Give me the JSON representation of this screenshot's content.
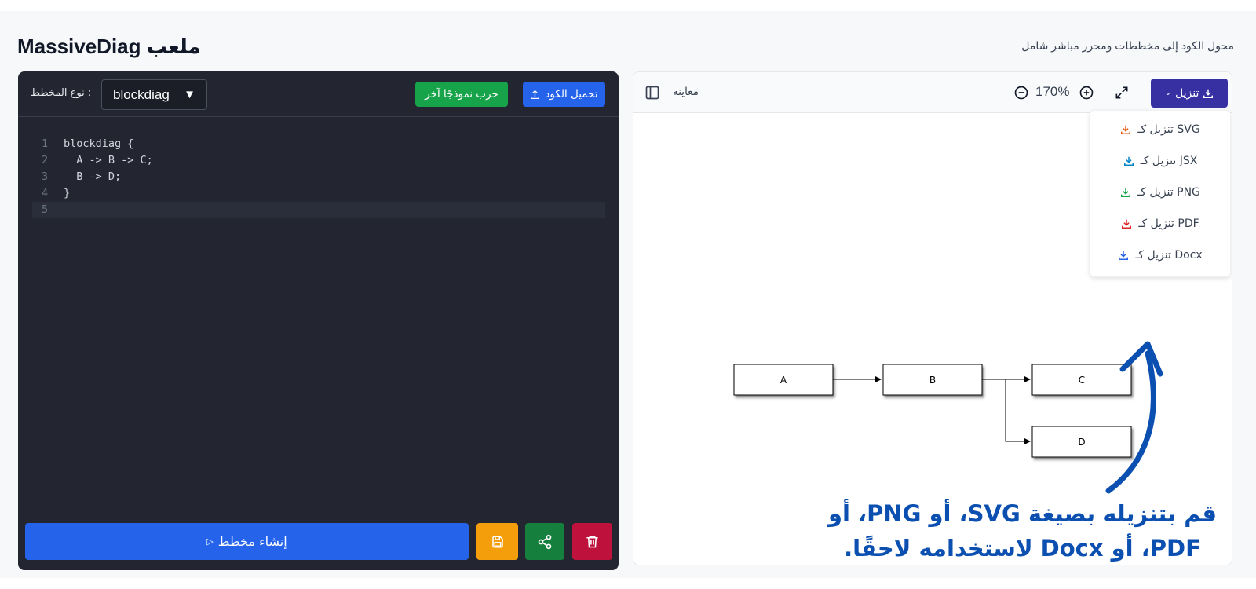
{
  "header": {
    "title": "MassiveDiag ملعب",
    "subtitle": "محول الكود إلى مخططات ومحرر مباشر شامل"
  },
  "editor": {
    "upload_label": "تحميل الكود",
    "example_label": "جرب نموذجًا آخر",
    "diagram_type_label": ": نوع المخطط",
    "diagram_type_value": "blockdiag",
    "code_lines": [
      {
        "num": "1",
        "text": "blockdiag {"
      },
      {
        "num": "2",
        "text": "  A -> B -> C;"
      },
      {
        "num": "3",
        "text": "  B -> D;"
      },
      {
        "num": "4",
        "text": "}"
      },
      {
        "num": "5",
        "text": ""
      }
    ],
    "generate_label": "إنشاء مخطط"
  },
  "preview": {
    "label": "معاينة",
    "zoom": "170%",
    "download_label": "تنزيل",
    "download_options": [
      {
        "label": "SVG تنزيل كـ",
        "color": "#ea580c"
      },
      {
        "label": "JSX تنزيل كـ",
        "color": "#0284c7"
      },
      {
        "label": "PNG تنزيل كـ",
        "color": "#16a34a"
      },
      {
        "label": "PDF تنزيل كـ",
        "color": "#dc2626"
      },
      {
        "label": "Docx تنزيل كـ",
        "color": "#2563eb"
      }
    ],
    "diagram": {
      "nodes": [
        "A",
        "B",
        "C",
        "D"
      ]
    }
  },
  "annotation": {
    "caption": "قم بتنزيله بصيغة SVG، أو PNG، أو PDF، أو Docx لاستخدامه لاحقًا."
  },
  "colors": {
    "editor_bg": "#232631",
    "primary": "#2563eb",
    "success": "#16a34a",
    "warning": "#f59e0b",
    "danger": "#be123c",
    "download_bg": "#3730a3",
    "annotation": "#0b4fb0"
  }
}
